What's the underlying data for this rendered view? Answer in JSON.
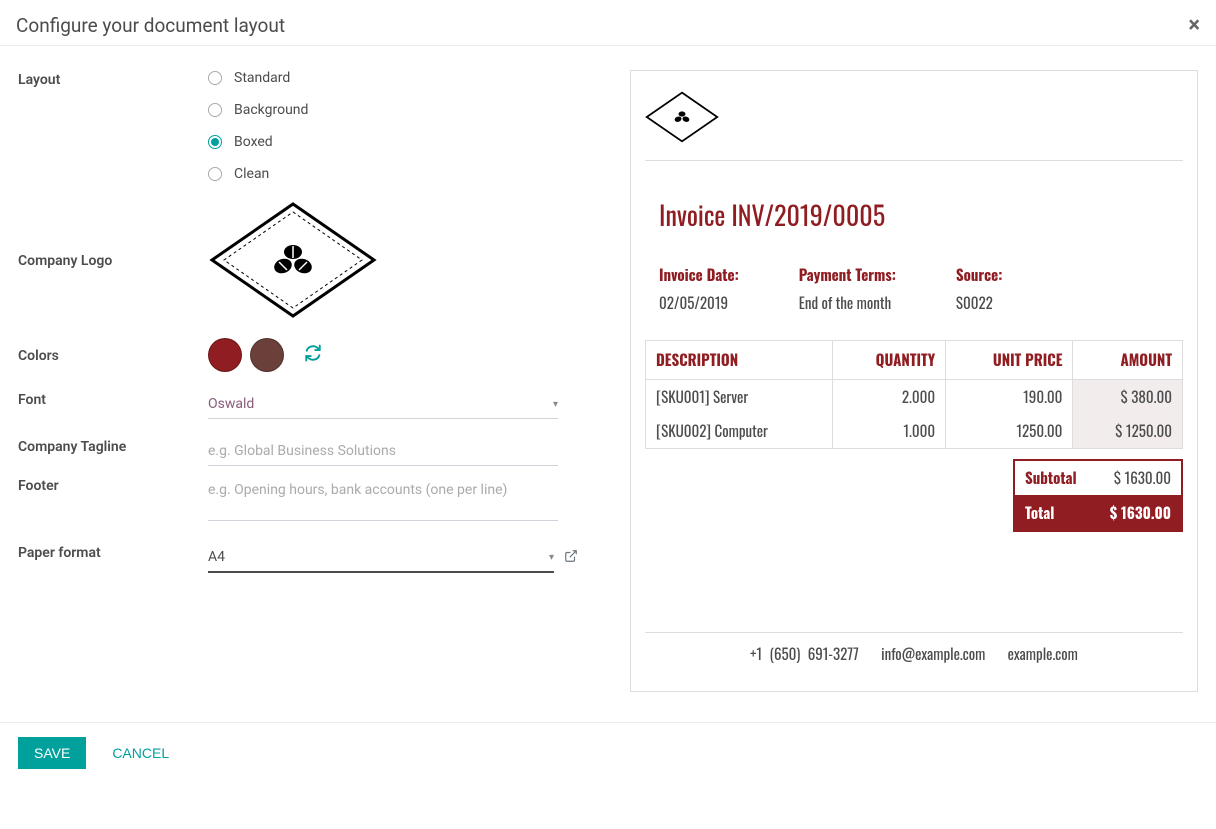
{
  "modal": {
    "title": "Configure your document layout",
    "save": "SAVE",
    "cancel": "CANCEL"
  },
  "form": {
    "labels": {
      "layout": "Layout",
      "logo": "Company Logo",
      "colors": "Colors",
      "font": "Font",
      "tagline": "Company Tagline",
      "footer": "Footer",
      "paper": "Paper format"
    },
    "layout_options": {
      "standard": "Standard",
      "background": "Background",
      "boxed": "Boxed",
      "clean": "Clean"
    },
    "layout_selected": "boxed",
    "colors": {
      "primary": "#8f1d22",
      "secondary": "#6b3f3a"
    },
    "font_value": "Oswald",
    "tagline_placeholder": "e.g. Global Business Solutions",
    "footer_placeholder": "e.g. Opening hours, bank accounts (one per line)",
    "paper_value": "A4"
  },
  "preview": {
    "title": "Invoice INV/2019/0005",
    "meta": {
      "date_label": "Invoice Date:",
      "date_value": "02/05/2019",
      "terms_label": "Payment Terms:",
      "terms_value": "End of the month",
      "source_label": "Source:",
      "source_value": "S0022"
    },
    "columns": {
      "desc": "DESCRIPTION",
      "qty": "QUANTITY",
      "price": "UNIT PRICE",
      "amount": "AMOUNT"
    },
    "rows": [
      {
        "desc": "[SKU001] Server",
        "qty": "2.000",
        "price": "190.00",
        "amount": "$ 380.00"
      },
      {
        "desc": "[SKU002] Computer",
        "qty": "1.000",
        "price": "1250.00",
        "amount": "$ 1250.00"
      }
    ],
    "totals": {
      "subtotal_label": "Subtotal",
      "subtotal_value": "$ 1630.00",
      "total_label": "Total",
      "total_value": "$ 1630.00"
    },
    "footer": {
      "phone": "+1 (650) 691-3277",
      "email": "info@example.com",
      "site": "example.com"
    }
  }
}
